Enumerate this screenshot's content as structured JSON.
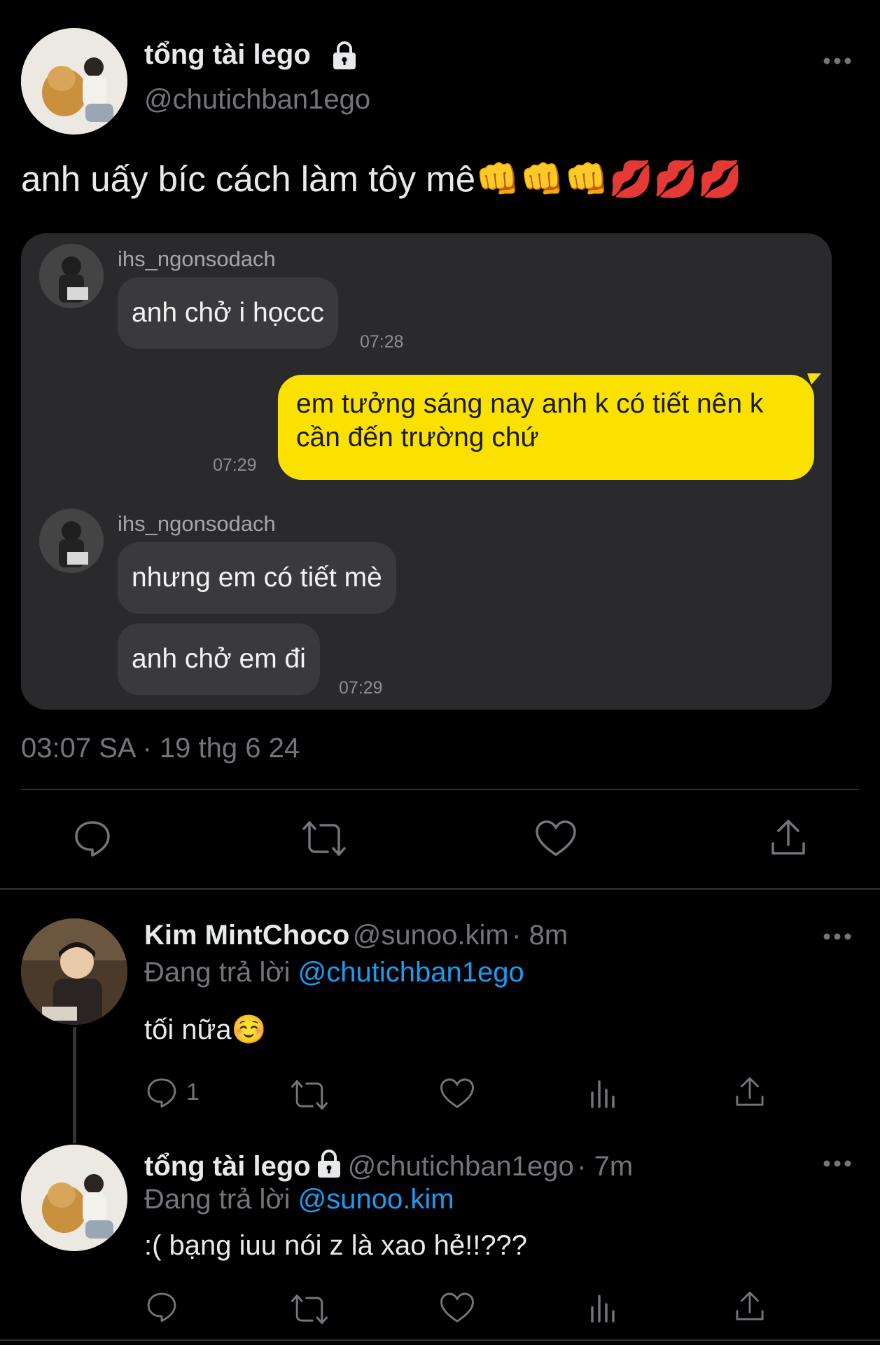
{
  "main_tweet": {
    "display_name": "tổng tài lego",
    "handle": "@chutichban1ego",
    "text": "anh uấy bíc cách làm tôy mê",
    "emojis": "👊👊👊💋💋💋",
    "timestamp": "03:07 SA · 19 thg 6 24"
  },
  "chat": {
    "messages": [
      {
        "sender": "ihs_ngonsodach",
        "text": "anh chở i họccc",
        "time": "07:28"
      },
      {
        "sender": "me",
        "text": "em tưởng sáng nay anh k có tiết nên k cần đến trường chứ",
        "time": "07:29"
      },
      {
        "sender": "ihs_ngonsodach",
        "text": "nhưng em có tiết mè",
        "time": ""
      },
      {
        "sender": "ihs_ngonsodach",
        "text": "anh chở em đi",
        "time": "07:29"
      }
    ]
  },
  "replies": [
    {
      "display_name": "Kim MintChoco",
      "handle": "@sunoo.kim",
      "age": "· 8m",
      "replying_label": "Đang trả lời",
      "replying_to": "@chutichban1ego",
      "text": "tối nữa☺️",
      "reply_count": "1"
    },
    {
      "display_name": "tổng tài lego",
      "handle": "@chutichban1ego",
      "age": "· 7m",
      "replying_label": "Đang trả lời",
      "replying_to": "@sunoo.kim",
      "text": ":( bạng iuu nói z là xao hẻ!!???",
      "reply_count": ""
    }
  ],
  "icons": {
    "more": "more-horizontal-icon",
    "reply": "reply-icon",
    "retweet": "retweet-icon",
    "like": "heart-icon",
    "share": "share-icon",
    "views": "views-icon",
    "lock": "lock-icon"
  },
  "colors": {
    "background": "#000000",
    "link": "#1d9bf0",
    "chat_card": "#2a2a2c",
    "yellow_bubble": "#fae100"
  }
}
